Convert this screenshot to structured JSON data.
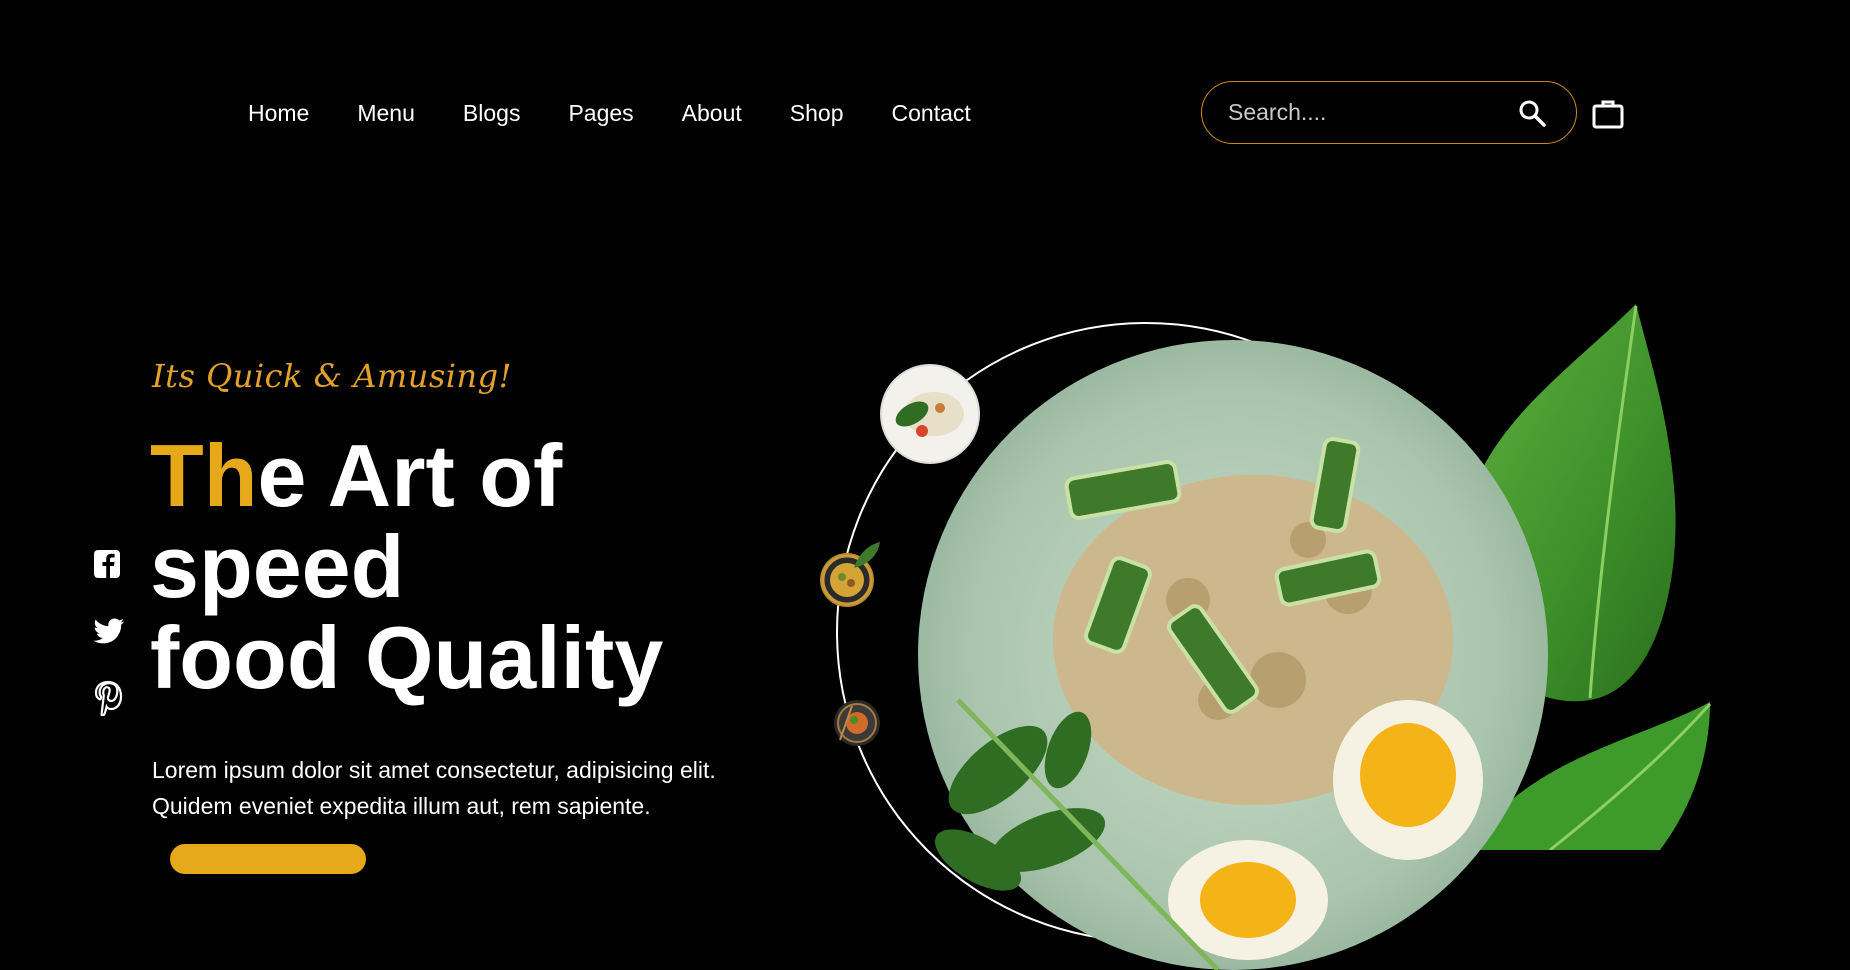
{
  "nav": {
    "items": [
      "Home",
      "Menu",
      "Blogs",
      "Pages",
      "About",
      "Shop",
      "Contact"
    ]
  },
  "search": {
    "placeholder": "Search....",
    "icon": "search-icon"
  },
  "cart": {
    "icon": "bag-icon"
  },
  "hero": {
    "tagline": "Its Quick & Amusing!",
    "headline_highlight": "Th",
    "headline_rest_line1": "e Art of",
    "headline_line2": "speed",
    "headline_line3": "food Quality",
    "description_line1": "Lorem ipsum dolor sit amet consectetur, adipisicing elit.",
    "description_line2": "Quidem eveniet expedita illum aut, rem sapiente."
  },
  "social": [
    "facebook-icon",
    "twitter-icon",
    "pinterest-icon"
  ],
  "colors": {
    "accent": "#e6a91a",
    "tagline": "#e1a12a",
    "search_border": "#c8901a",
    "background": "#000000"
  }
}
